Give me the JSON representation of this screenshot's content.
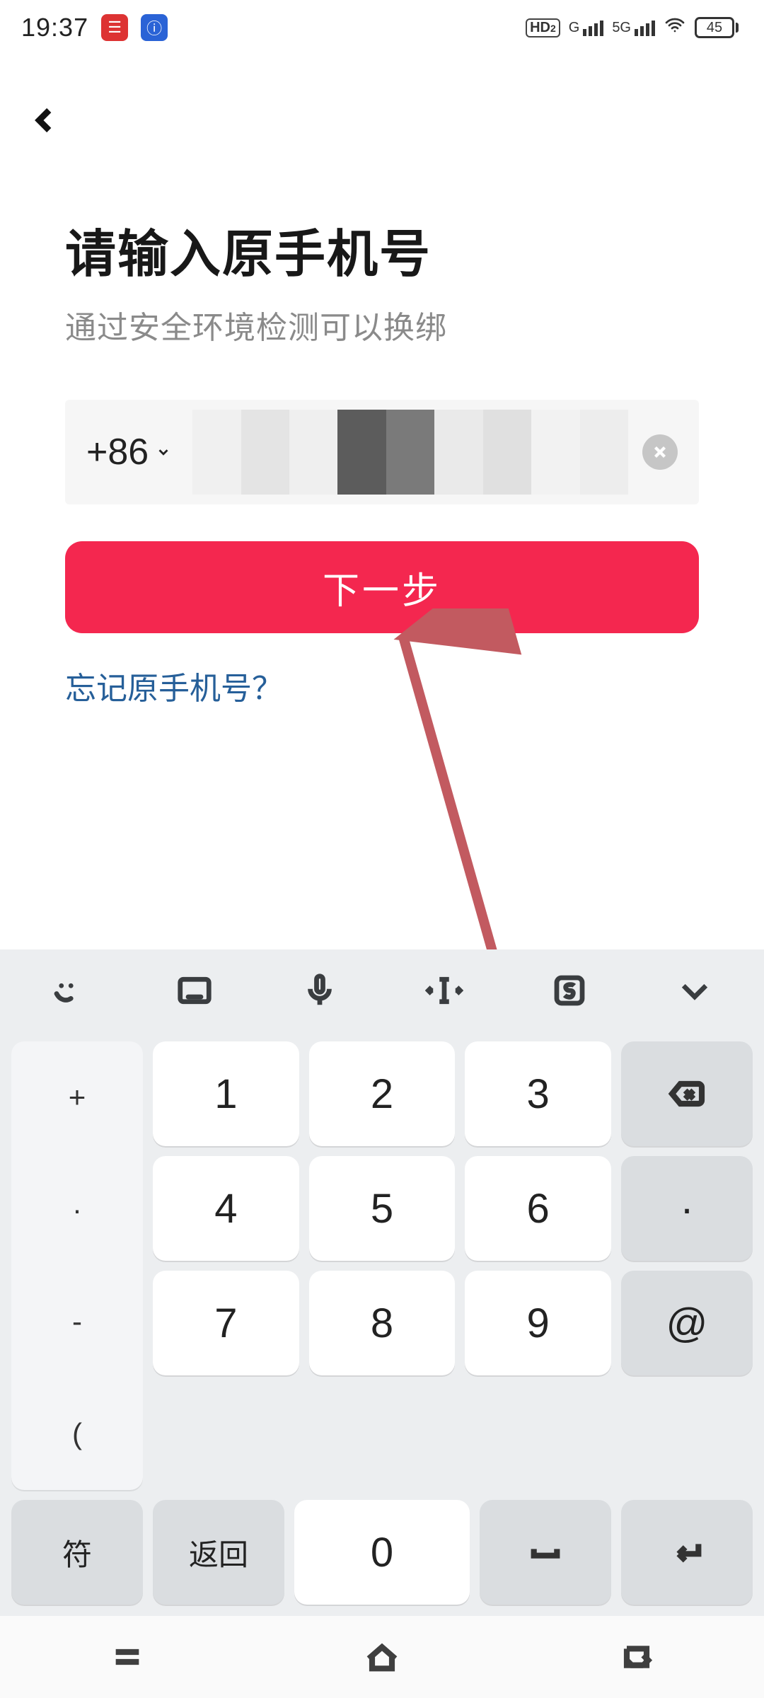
{
  "statusbar": {
    "time": "19:37",
    "hd_label": "HD",
    "hd_sub": "2",
    "sig1_label": "G",
    "sig2_label": "5G",
    "battery_pct": "45"
  },
  "page": {
    "title": "请输入原手机号",
    "subtitle": "通过安全环境检测可以换绑",
    "country_code": "+86",
    "next_button": "下一步",
    "forgot_link": "忘记原手机号？"
  },
  "keyboard": {
    "side_left": [
      "+",
      "·",
      "-",
      "("
    ],
    "row1": [
      "1",
      "2",
      "3"
    ],
    "row2": [
      "4",
      "5",
      "6"
    ],
    "row3": [
      "7",
      "8",
      "9"
    ],
    "side_right_r2": "·",
    "side_right_r3": "@",
    "bottom_sym": "符",
    "bottom_back": "返回",
    "bottom_zero": "0"
  }
}
